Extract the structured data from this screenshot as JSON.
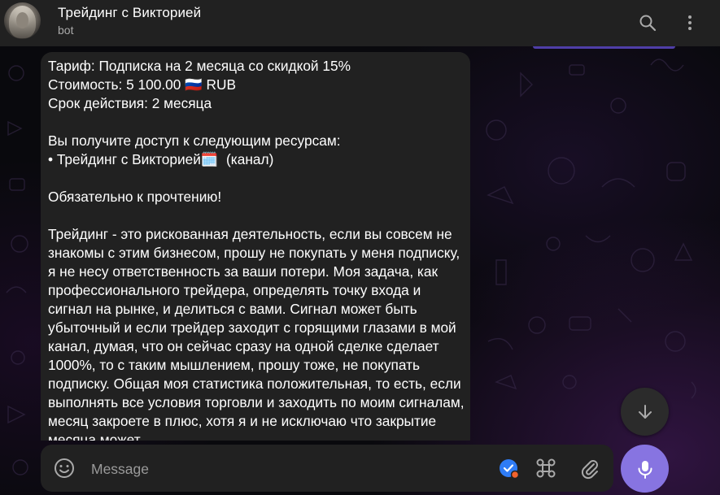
{
  "header": {
    "title": "Трейдинг с Викторией",
    "subtitle": "bot"
  },
  "message": {
    "text": "Тариф: Подписка на 2 месяца со скидкой 15%\nСтоимость: 5 100.00 🇷🇺 RUB\nСрок действия: 2 месяца\n\nВы получите доступ к следующим ресурсам:\n• Трейдинг с Викторией🗓️  (канал)\n\nОбязательно к прочтению!\n\nТрейдинг - это рискованная деятельность, если вы совсем не знакомы с этим бизнесом, прошу не покупать у меня подписку, я не несу ответственность за ваши потери. Моя задача, как профессионального трейдера, определять точку входа и сигнал на рынке, и делиться с вами. Сигнал может быть убыточный и если трейдер заходит с горящими глазами в мой канал, думая, что он сейчас сразу на одной сделке сделает 1000%, то с таким мышлением, прошу тоже, не покупать подписку. Общая моя статистика положительная, то есть, если выполнять все условия торговли и заходить по моим сигналам, месяц закроете в плюс, хотя я и не исключаю что закрытие месяца может"
  },
  "composer": {
    "placeholder": "Message"
  },
  "icons": {
    "search": "search-icon",
    "more": "more-vertical-icon",
    "emoji": "emoji-icon",
    "verified": "verified-badge-icon",
    "command": "command-icon",
    "attach": "attach-icon",
    "mic": "microphone-icon",
    "scroll": "arrow-down-icon"
  },
  "colors": {
    "accent": "#8774e1",
    "header_bg": "#212121",
    "bubble_bg": "#212121",
    "verified_blue": "#2f7cf6",
    "verified_dot": "#f0622d"
  }
}
